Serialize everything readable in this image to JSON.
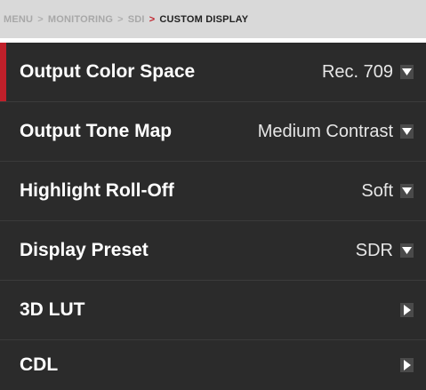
{
  "breadcrumb": {
    "items": [
      "MENU",
      "MONITORING",
      "SDI",
      "CUSTOM DISPLAY"
    ],
    "separator": ">"
  },
  "menu": {
    "rows": [
      {
        "label": "Output Color Space",
        "value": "Rec. 709",
        "icon": "chevron-down-icon",
        "selected": true
      },
      {
        "label": "Output Tone Map",
        "value": "Medium Contrast",
        "icon": "chevron-down-icon",
        "selected": false
      },
      {
        "label": "Highlight Roll-Off",
        "value": "Soft",
        "icon": "chevron-down-icon",
        "selected": false
      },
      {
        "label": "Display Preset",
        "value": "SDR",
        "icon": "chevron-down-icon",
        "selected": false
      },
      {
        "label": "3D LUT",
        "value": "",
        "icon": "chevron-right-icon",
        "selected": false
      },
      {
        "label": "CDL",
        "value": "",
        "icon": "chevron-right-icon",
        "selected": false
      }
    ]
  },
  "colors": {
    "accent": "#c0202a",
    "background": "#2b2b2b",
    "breadcrumb_bg": "#d9d9d9"
  }
}
